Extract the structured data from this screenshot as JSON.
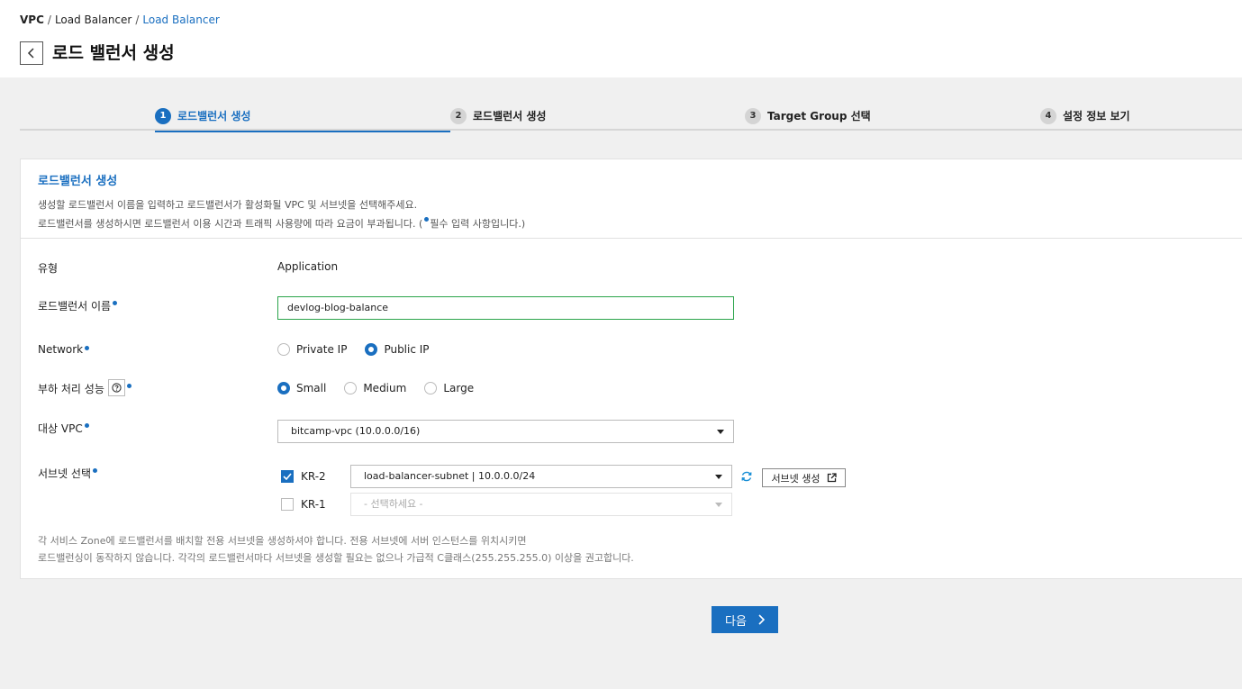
{
  "breadcrumb": {
    "root": "VPC",
    "sep1": "/",
    "level1": "Load Balancer",
    "sep2": "/",
    "current": "Load Balancer"
  },
  "page_title": "로드 밸런서 생성",
  "steps": [
    {
      "num": "1",
      "label": "로드밸런서 생성"
    },
    {
      "num": "2",
      "label": "로드밸런서 생성"
    },
    {
      "num": "3",
      "label": "Target Group 선택"
    },
    {
      "num": "4",
      "label": "설정 정보 보기"
    }
  ],
  "active_step": 1,
  "panel": {
    "title": "로드밸런서 생성",
    "desc1": "생성할 로드밸런서 이름을 입력하고 로드밸런서가 활성화될 VPC 및 서브넷을 선택해주세요.",
    "desc2_pre": "로드밸런서를 생성하시면 로드밸런서 이용 시간과 트래픽 사용량에 따라 요금이 부과됩니다. (",
    "desc2_post": "필수 입력 사항입니다.)"
  },
  "form": {
    "type": {
      "label": "유형",
      "value": "Application"
    },
    "name": {
      "label": "로드밸런서 이름",
      "value": "devlog-blog-balance"
    },
    "network": {
      "label": "Network",
      "options": [
        "Private IP",
        "Public IP"
      ],
      "selected": "Public IP"
    },
    "performance": {
      "label": "부하 처리 성능",
      "options": [
        "Small",
        "Medium",
        "Large"
      ],
      "selected": "Small"
    },
    "vpc": {
      "label": "대상 VPC",
      "value": "bitcamp-vpc (10.0.0.0/16)"
    },
    "subnet": {
      "label": "서브넷 선택",
      "zones": [
        {
          "zone": "KR-2",
          "checked": true,
          "value": "load-balancer-subnet | 10.0.0.0/24"
        },
        {
          "zone": "KR-1",
          "checked": false,
          "value": "- 선택하세요 -"
        }
      ],
      "create_button": "서브넷 생성"
    }
  },
  "note": {
    "line1": "각 서비스 Zone에 로드밸런서를 배치할 전용 서브넷을 생성하셔야 합니다. 전용 서브넷에 서버 인스턴스를 위치시키면",
    "line2": "로드밸런싱이 동작하지 않습니다. 각각의 로드밸런서마다 서브넷을 생성할 필요는 없으나 가급적 C클래스(255.255.255.0) 이상을 권고합니다."
  },
  "next_button": "다음",
  "colors": {
    "accent": "#1a6fc0",
    "input_border_valid": "#2aa44a"
  }
}
